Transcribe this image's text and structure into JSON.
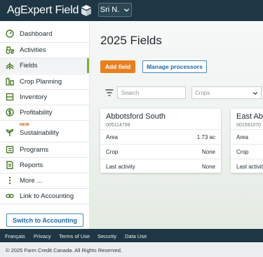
{
  "header": {
    "brand": "AgExpert Field",
    "user_label": "Sri N."
  },
  "sidebar": {
    "items": [
      {
        "label": "Dashboard",
        "icon": "dashboard-icon"
      },
      {
        "label": "Activities",
        "icon": "tractor-icon"
      },
      {
        "label": "Fields",
        "icon": "fields-icon",
        "active": true
      },
      {
        "label": "Crop Planning",
        "icon": "crop-planning-icon"
      },
      {
        "label": "Inventory",
        "icon": "inventory-icon"
      },
      {
        "label": "Profitability",
        "icon": "dollar-icon"
      },
      {
        "label": "Sustainability",
        "icon": "sprout-icon",
        "badge": "NEW"
      },
      {
        "label": "Programs",
        "icon": "programs-icon"
      },
      {
        "label": "Reports",
        "icon": "reports-icon"
      },
      {
        "label": "More ...",
        "icon": "more-vertical-icon"
      },
      {
        "label": "Link to Accounting",
        "icon": "link-icon"
      }
    ],
    "switch_label": "Switch to Accounting"
  },
  "main": {
    "title": "2025 Fields",
    "add_field_label": "Add field",
    "manage_processors_label": "Manage processors",
    "search_placeholder": "Search",
    "crops_placeholder": "Crops",
    "cards": [
      {
        "name": "Abbotsford South",
        "id": "005114799",
        "rows": [
          {
            "label": "Area",
            "value": "1.73 ac"
          },
          {
            "label": "Crop",
            "value": "None"
          },
          {
            "label": "Last activity",
            "value": "None"
          }
        ]
      },
      {
        "name": "East Abb",
        "id": "001591070",
        "rows": [
          {
            "label": "Area",
            "value": ""
          },
          {
            "label": "Crop",
            "value": ""
          },
          {
            "label": "Last activity",
            "value": ""
          }
        ]
      }
    ]
  },
  "footer": {
    "links": [
      "Français",
      "Privacy",
      "Terms of Use",
      "Security",
      "Data Use"
    ],
    "copyright": "© 2025 Farm Credit Canada. All Rights Reserved."
  },
  "colors": {
    "header_bg": "#1f3744",
    "accent_green": "#7ab03d",
    "primary_orange": "#e8801f",
    "link_blue": "#1c6aa3"
  }
}
